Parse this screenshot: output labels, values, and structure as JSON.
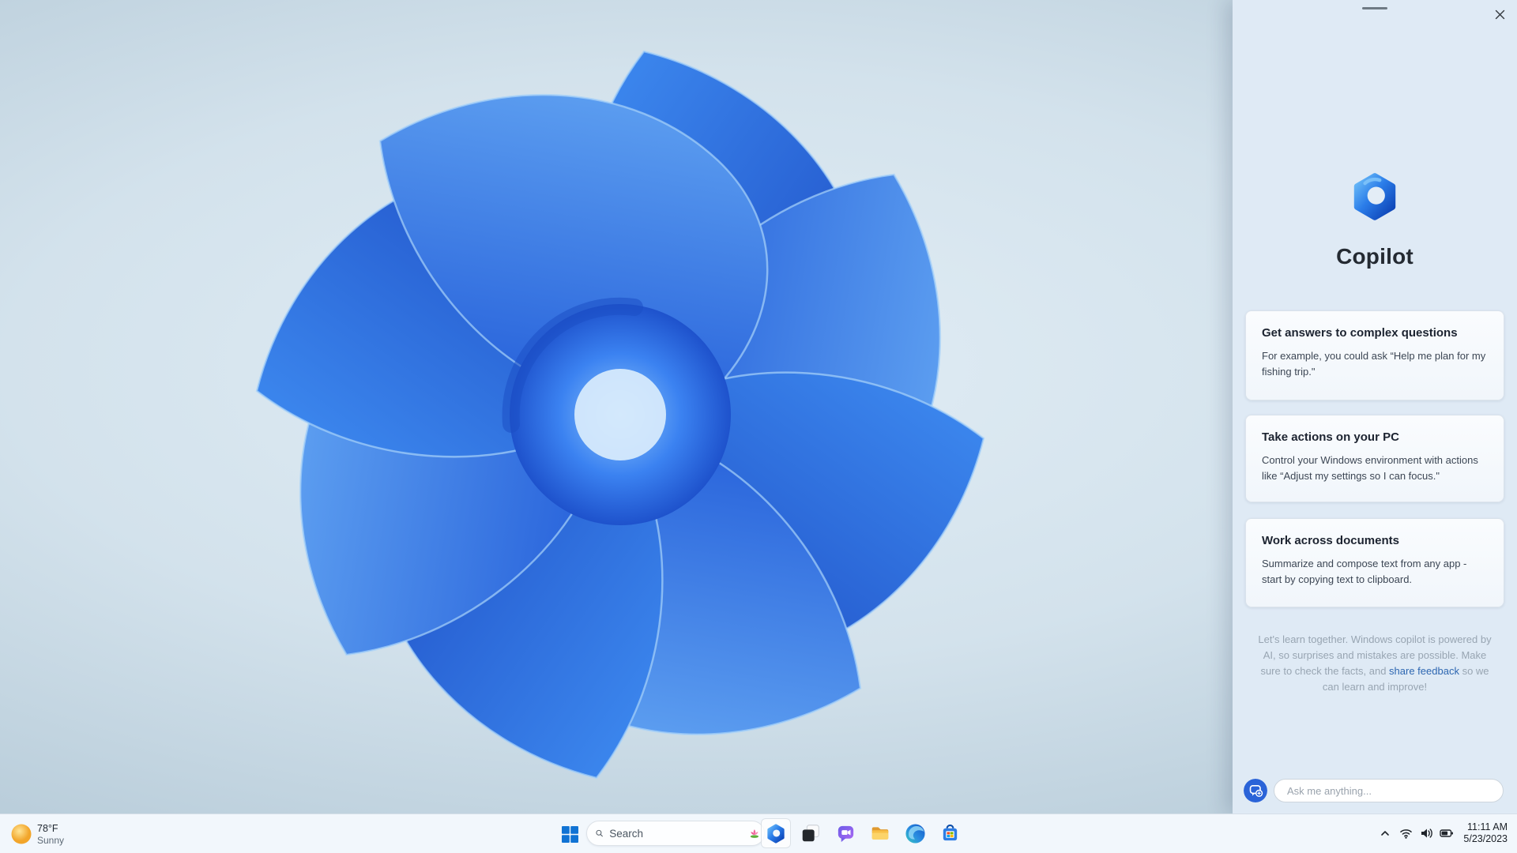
{
  "colors": {
    "accent_blue": "#2a63d8",
    "link_blue": "#2e67b1",
    "panel_background": "#dfeaf5",
    "wallpaper_blue_dark": "#1a46c0",
    "wallpaper_blue_light": "#6db1f7"
  },
  "copilot_panel": {
    "title": "Copilot",
    "cards": [
      {
        "title": "Get answers to complex questions",
        "body": "For example, you could ask “Help me plan for my fishing trip.\""
      },
      {
        "title": "Take actions on your PC",
        "body": "Control your Windows environment with actions like “Adjust my settings so I can focus.\""
      },
      {
        "title": "Work across documents",
        "body": "Summarize and compose text from any app - start by copying text to clipboard."
      }
    ],
    "disclaimer": {
      "before": "Let's learn together. Windows copilot is powered by AI, so surprises and mistakes are possible. Make sure to check the facts, and ",
      "link": "share feedback",
      "after": " so we can learn and improve!"
    },
    "input_placeholder": "Ask me anything...",
    "icons": {
      "logo": "copilot-logo",
      "close": "close-icon",
      "drag": "drag-handle",
      "new_chat": "new-chat-icon"
    }
  },
  "taskbar": {
    "weather": {
      "temperature": "78°F",
      "condition": "Sunny"
    },
    "search_placeholder": "Search",
    "apps": [
      {
        "name": "copilot",
        "active": true
      },
      {
        "name": "task-view",
        "active": false
      },
      {
        "name": "chat",
        "active": false
      },
      {
        "name": "file-explorer",
        "active": false
      },
      {
        "name": "edge",
        "active": false
      },
      {
        "name": "store",
        "active": false
      }
    ],
    "tray": {
      "time": "11:11 AM",
      "date": "5/23/2023"
    }
  }
}
